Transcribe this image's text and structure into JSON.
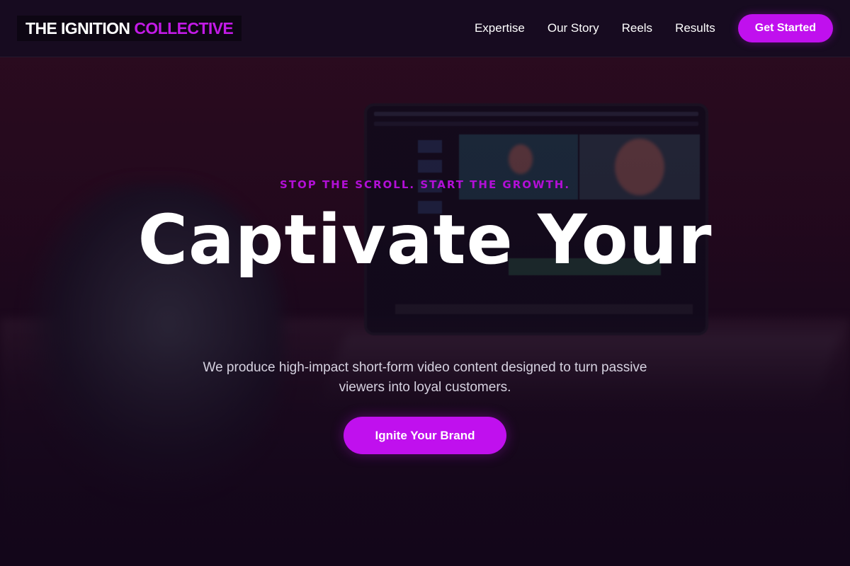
{
  "brand": {
    "name_primary": "THE IGNITION",
    "name_accent": "COLLECTIVE",
    "accent_color": "#c010ee"
  },
  "nav": {
    "items": [
      {
        "label": "Expertise"
      },
      {
        "label": "Our Story"
      },
      {
        "label": "Reels"
      },
      {
        "label": "Results"
      }
    ],
    "cta_label": "Get Started"
  },
  "hero": {
    "eyebrow": "STOP THE SCROLL. START THE GROWTH.",
    "headline": "Captivate Your",
    "subtitle": "We produce high-impact short-form video content designed to turn passive viewers into loyal customers.",
    "cta_label": "Ignite Your Brand",
    "background_description_icon": "laptop-video-editing-photo"
  }
}
